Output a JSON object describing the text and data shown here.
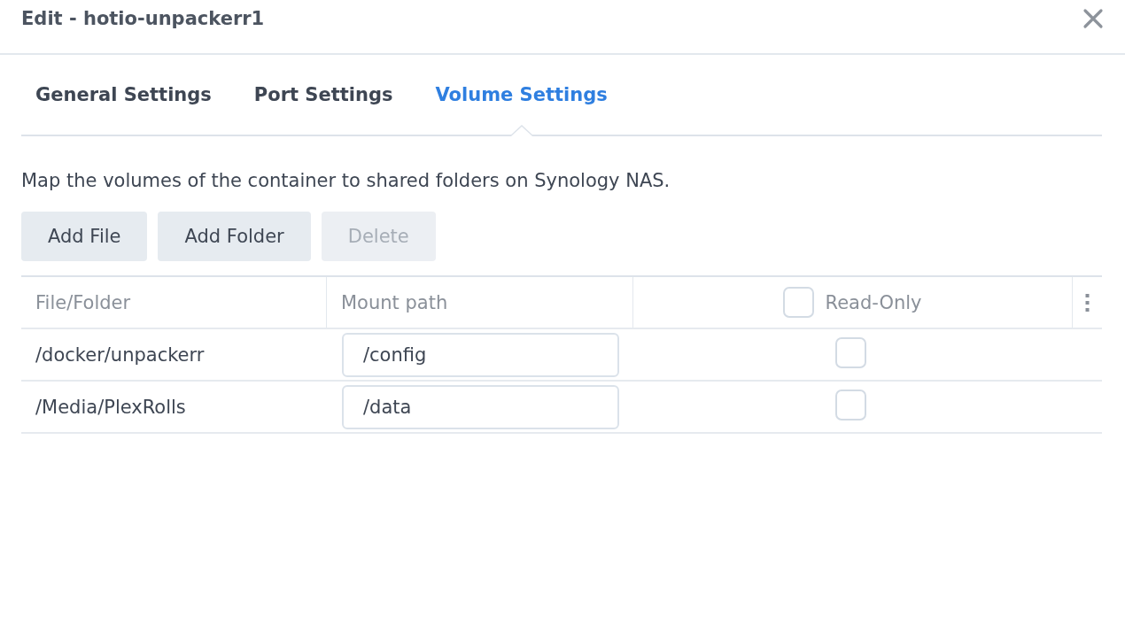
{
  "window": {
    "title": "Edit - hotio-unpackerr1"
  },
  "tabs": [
    {
      "label": "General Settings",
      "selected": false
    },
    {
      "label": "Port Settings",
      "selected": false
    },
    {
      "label": "Volume Settings",
      "selected": true
    }
  ],
  "description": "Map the volumes of the container to shared folders on Synology NAS.",
  "buttons": [
    {
      "label": "Add File",
      "disabled": false
    },
    {
      "label": "Add Folder",
      "disabled": false
    },
    {
      "label": "Delete",
      "disabled": true
    }
  ],
  "table": {
    "columns": [
      "File/Folder",
      "Mount path",
      "Read-Only"
    ],
    "read_only_all_checked": false,
    "rows": [
      {
        "file_folder": "/docker/unpackerr",
        "mount_path": "/config",
        "read_only": false
      },
      {
        "file_folder": "/Media/PlexRolls",
        "mount_path": "/data",
        "read_only": false
      }
    ]
  }
}
